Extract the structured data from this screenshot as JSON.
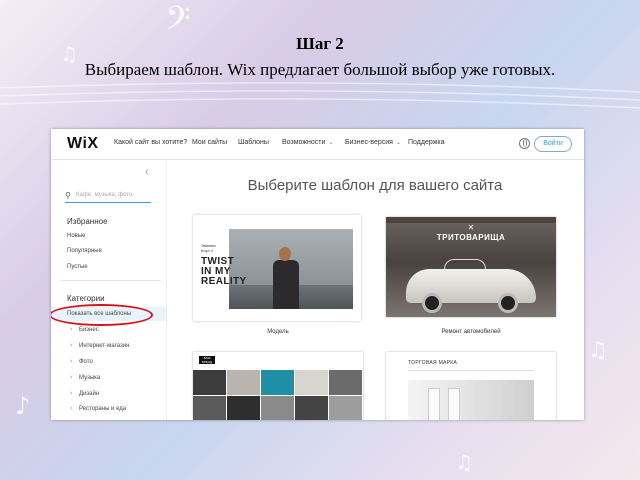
{
  "slide": {
    "title": "Шаг 2",
    "subtitle": "Выбираем шаблон. Wix предлагает большой выбор уже готовых."
  },
  "topbar": {
    "logo": "WiX",
    "nav": [
      {
        "label": "Какой сайт вы хотите?",
        "dropdown": false
      },
      {
        "label": "Мои сайты",
        "dropdown": false
      },
      {
        "label": "Шаблоны",
        "dropdown": false
      },
      {
        "label": "Возможности",
        "dropdown": true
      },
      {
        "label": "Бизнес-версия",
        "dropdown": true
      },
      {
        "label": "Поддержка",
        "dropdown": false
      }
    ],
    "login_label": "Войти"
  },
  "sidebar": {
    "search_placeholder": "Кафе, музыка, фото",
    "favorites_heading": "Избранное",
    "favorites": [
      "Новые",
      "Популярные",
      "Пустые"
    ],
    "categories_heading": "Категории",
    "show_all": "Показать все шаблоны",
    "categories": [
      "Бизнес",
      "Интернет-магазин",
      "Фото",
      "Музыка",
      "Дизайн",
      "Рестораны и еда"
    ]
  },
  "main": {
    "heading": "Выберите шаблон для вашего сайта",
    "templates": [
      {
        "caption": "Модель",
        "small_text": "Эмилия\nКоул //",
        "big_text": "TWIST\nIN MY\nREALITY"
      },
      {
        "caption": "Ремонт автомобилей",
        "logo_text": "ТРИТОВАРИЩА"
      },
      {
        "caption": "",
        "brand": "ВАШ БРЕНД"
      },
      {
        "caption": "",
        "title_text": "ТОРГОВАЯ МАРКА"
      }
    ]
  },
  "colors": {
    "accent": "#3899ec",
    "highlight_oval": "#d4141b",
    "selected_row_bg": "#e8f3fd"
  }
}
